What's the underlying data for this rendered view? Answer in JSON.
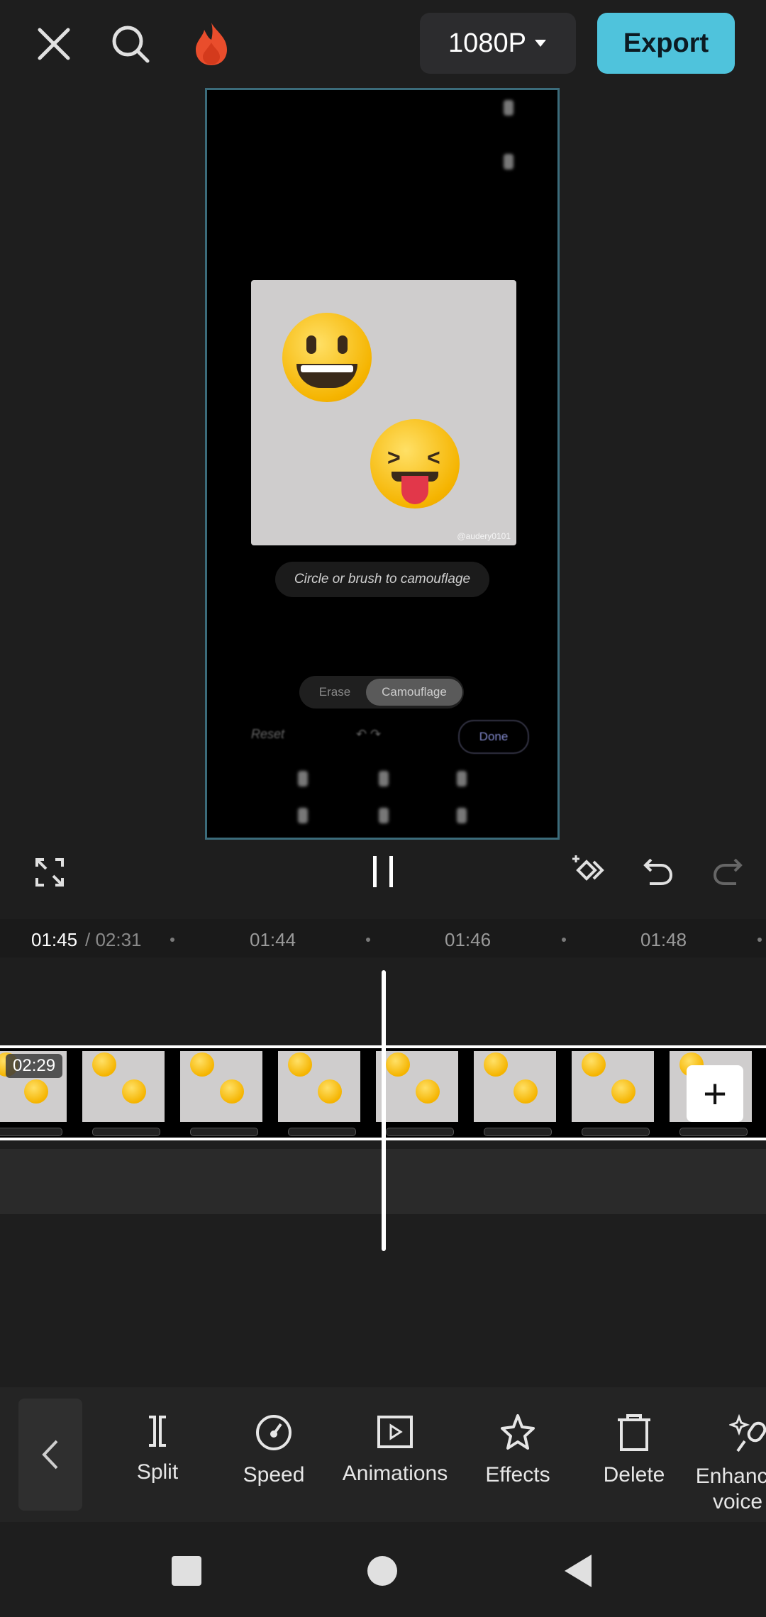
{
  "topbar": {
    "resolution": "1080P",
    "export_label": "Export"
  },
  "preview": {
    "hint": "Circle or brush to camouflage",
    "segment": [
      "Erase",
      "Camouflage"
    ],
    "reset": "Reset",
    "done": "Done",
    "watermark": "@audery0101"
  },
  "timeline": {
    "current": "01:45",
    "total": "/ 02:31",
    "ticks": [
      "01:44",
      "01:46",
      "01:48"
    ],
    "clip_duration": "02:29"
  },
  "toolbar": {
    "items": [
      {
        "label": "Split",
        "icon": "split-icon"
      },
      {
        "label": "Speed",
        "icon": "speed-icon"
      },
      {
        "label": "Animations",
        "icon": "animations-icon"
      },
      {
        "label": "Effects",
        "icon": "effects-icon"
      },
      {
        "label": "Delete",
        "icon": "delete-icon"
      },
      {
        "label": "Enhance voice",
        "icon": "enhance-voice-icon"
      }
    ]
  },
  "colors": {
    "accent": "#4fc3dc",
    "background": "#1e1e1e"
  }
}
